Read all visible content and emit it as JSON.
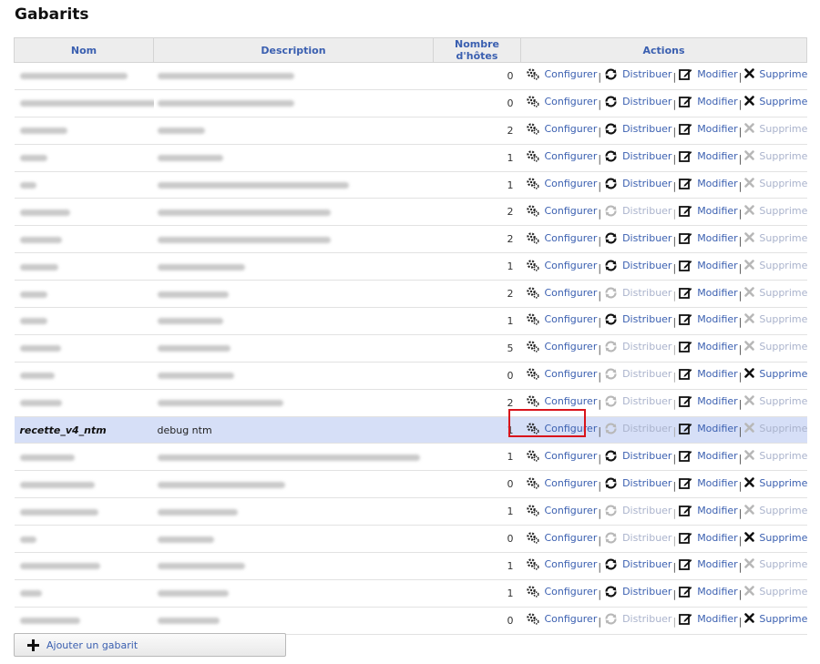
{
  "page": {
    "title": "Gabarits"
  },
  "table": {
    "headers": [
      "Nom",
      "Description",
      "Nombre d'hôtes",
      "Actions"
    ],
    "rows": [
      {
        "name": null,
        "desc": null,
        "count": "0",
        "distribute": true,
        "delete": true,
        "selected": false
      },
      {
        "name": null,
        "desc": null,
        "count": "0",
        "distribute": true,
        "delete": true,
        "selected": false
      },
      {
        "name": null,
        "desc": null,
        "count": "2",
        "distribute": true,
        "delete": false,
        "selected": false
      },
      {
        "name": null,
        "desc": null,
        "count": "1",
        "distribute": true,
        "delete": false,
        "selected": false
      },
      {
        "name": null,
        "desc": null,
        "count": "1",
        "distribute": true,
        "delete": false,
        "selected": false
      },
      {
        "name": null,
        "desc": null,
        "count": "2",
        "distribute": false,
        "delete": false,
        "selected": false
      },
      {
        "name": null,
        "desc": null,
        "count": "2",
        "distribute": true,
        "delete": false,
        "selected": false
      },
      {
        "name": null,
        "desc": null,
        "count": "1",
        "distribute": true,
        "delete": false,
        "selected": false
      },
      {
        "name": null,
        "desc": null,
        "count": "2",
        "distribute": false,
        "delete": false,
        "selected": false
      },
      {
        "name": null,
        "desc": null,
        "count": "1",
        "distribute": true,
        "delete": false,
        "selected": false
      },
      {
        "name": null,
        "desc": null,
        "count": "5",
        "distribute": false,
        "delete": false,
        "selected": false
      },
      {
        "name": null,
        "desc": null,
        "count": "0",
        "distribute": false,
        "delete": true,
        "selected": false
      },
      {
        "name": null,
        "desc": null,
        "count": "2",
        "distribute": false,
        "delete": false,
        "selected": false
      },
      {
        "name": "recette_v4_ntm",
        "desc": "debug ntm",
        "count": "1",
        "distribute": false,
        "delete": false,
        "selected": true
      },
      {
        "name": null,
        "desc": null,
        "count": "1",
        "distribute": true,
        "delete": false,
        "selected": false
      },
      {
        "name": null,
        "desc": null,
        "count": "0",
        "distribute": true,
        "delete": true,
        "selected": false
      },
      {
        "name": null,
        "desc": null,
        "count": "1",
        "distribute": false,
        "delete": false,
        "selected": false
      },
      {
        "name": null,
        "desc": null,
        "count": "0",
        "distribute": false,
        "delete": true,
        "selected": false
      },
      {
        "name": null,
        "desc": null,
        "count": "1",
        "distribute": true,
        "delete": false,
        "selected": false
      },
      {
        "name": null,
        "desc": null,
        "count": "1",
        "distribute": true,
        "delete": false,
        "selected": false
      },
      {
        "name": null,
        "desc": null,
        "count": "0",
        "distribute": false,
        "delete": true,
        "selected": false
      }
    ]
  },
  "actions": {
    "configure": "Configurer",
    "distribute": "Distribuer",
    "modify": "Modifier",
    "delete": "Supprimer",
    "separator": "|"
  },
  "add_button": {
    "label": "Ajouter un gabarit",
    "icon": "plus-icon"
  },
  "colors": {
    "link": "#3a5fb0",
    "link_disabled": "#aab3cc",
    "selected_row": "#d6dff7",
    "highlight": "#d9141b"
  }
}
